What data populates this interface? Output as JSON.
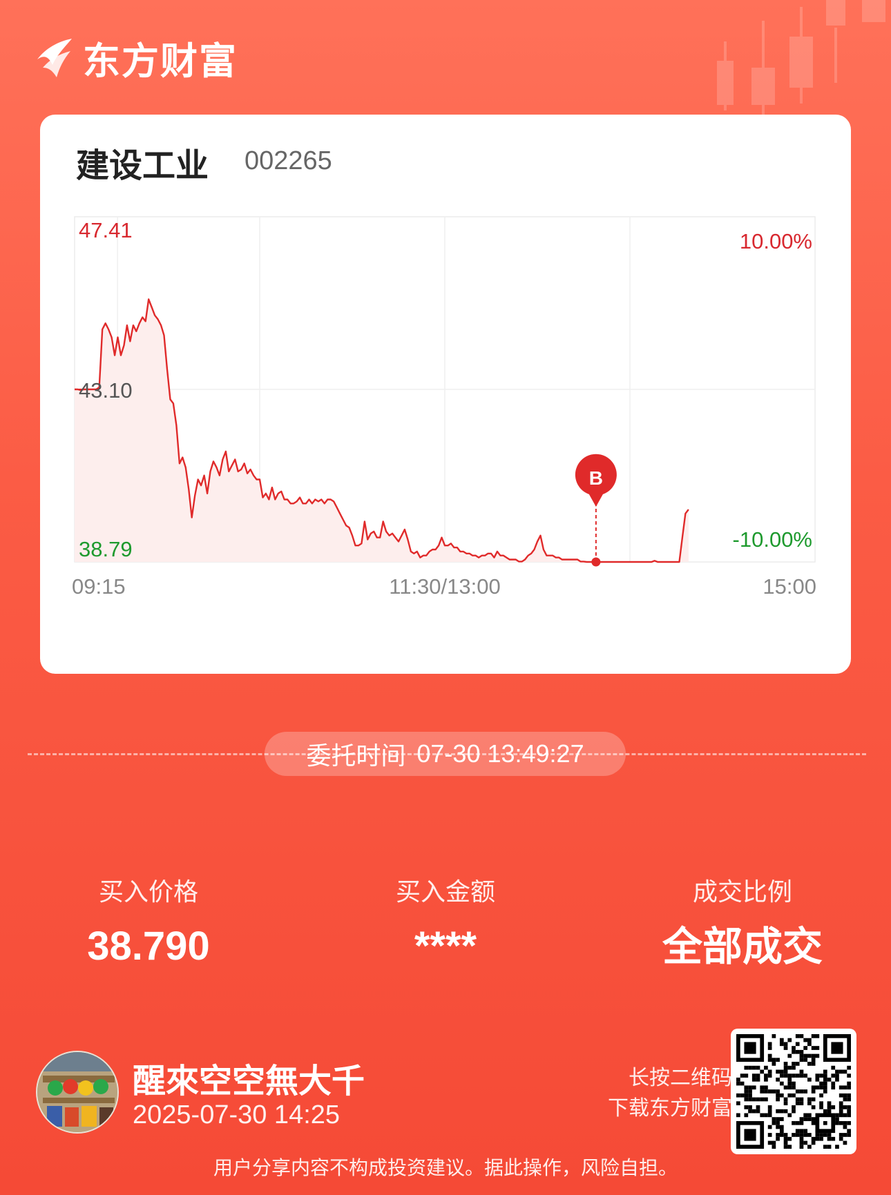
{
  "brand": {
    "name": "东方财富"
  },
  "stock": {
    "name": "建设工业",
    "code": "002265"
  },
  "chart_data": {
    "type": "line",
    "title": "",
    "xlabel": "",
    "ylabel": "",
    "x_ticks": [
      "09:15",
      "11:30/13:00",
      "15:00"
    ],
    "y_left_labels": {
      "top": "47.41",
      "mid": "43.10",
      "bottom": "38.79"
    },
    "y_right_labels": {
      "top": "10.00%",
      "bottom": "-10.00%"
    },
    "ylim": [
      38.79,
      47.41
    ],
    "reference_price": 43.1,
    "grid": true,
    "colors": {
      "line": "#e02a2a",
      "up": "#d8282f",
      "down": "#1e9a2e",
      "fill": "#fde8e6"
    },
    "series": [
      {
        "values": [
          43.1,
          43.1,
          43.08,
          43.1,
          43.1,
          43.1,
          43.1,
          43.1,
          43.15,
          44.6,
          44.75,
          44.6,
          44.4,
          43.95,
          44.4,
          43.95,
          44.2,
          44.7,
          44.3,
          44.7,
          44.55,
          44.75,
          44.9,
          44.8,
          45.35,
          45.15,
          44.95,
          44.85,
          44.7,
          44.45,
          43.6,
          42.85,
          42.75,
          42.2,
          41.25,
          41.4,
          41.15,
          40.6,
          39.9,
          40.45,
          40.85,
          40.7,
          40.95,
          40.5,
          41.05,
          41.3,
          41.15,
          40.95,
          41.35,
          41.55,
          41.05,
          41.2,
          41.35,
          41.05,
          41.1,
          41.25,
          41.0,
          41.1,
          40.95,
          40.85,
          40.85,
          40.4,
          40.5,
          40.35,
          40.65,
          40.35,
          40.5,
          40.55,
          40.35,
          40.35,
          40.25,
          40.25,
          40.3,
          40.4,
          40.25,
          40.25,
          40.35,
          40.25,
          40.35,
          40.3,
          40.35,
          40.25,
          40.35,
          40.35,
          40.3,
          40.15,
          40.0,
          39.85,
          39.7,
          39.65,
          39.45,
          39.2,
          39.2,
          39.25,
          39.8,
          39.35,
          39.5,
          39.55,
          39.4,
          39.4,
          39.8,
          39.55,
          39.45,
          39.5,
          39.4,
          39.3,
          39.45,
          39.6,
          39.35,
          39.05,
          39.0,
          39.05,
          38.9,
          38.95,
          38.95,
          39.05,
          39.1,
          39.1,
          39.2,
          39.4,
          39.2,
          39.2,
          39.25,
          39.15,
          39.15,
          39.05,
          39.05,
          39.0,
          39.0,
          38.95,
          38.95,
          38.9,
          38.95,
          38.95,
          39.0,
          39.0,
          38.9,
          39.05,
          38.95,
          38.95,
          38.9,
          38.85,
          38.85,
          38.85,
          38.8,
          38.8,
          38.85,
          38.95,
          39.0,
          39.1,
          39.3,
          39.45,
          39.1,
          38.95,
          38.95,
          38.95,
          38.9,
          38.9,
          38.85,
          38.85,
          38.85,
          38.85,
          38.85,
          38.85,
          38.8,
          38.8,
          38.79,
          38.79,
          38.79,
          38.79,
          38.79,
          38.79,
          38.79,
          38.79,
          38.79,
          38.79,
          38.79,
          38.79,
          38.79,
          38.79,
          38.79,
          38.79,
          38.79,
          38.79,
          38.79,
          38.79,
          38.79,
          38.79,
          38.82,
          38.79,
          38.79,
          38.79,
          38.79,
          38.79,
          38.79,
          38.79,
          38.79,
          39.4,
          40.0,
          40.1
        ]
      }
    ],
    "buy_marker": {
      "label": "B",
      "time": "13:49",
      "price": 38.79
    }
  },
  "entrust": {
    "label": "委托时间",
    "value": "07-30 13:49:27"
  },
  "stats": [
    {
      "label": "买入价格",
      "value": "38.790"
    },
    {
      "label": "买入金额",
      "value": "****"
    },
    {
      "label": "成交比例",
      "value": "全部成交"
    }
  ],
  "user": {
    "name": "醒來空空無大千",
    "time": "2025-07-30 14:25"
  },
  "qr_hint": {
    "line1": "长按二维码",
    "line2": "下载东方财富"
  },
  "disclaimer": "用户分享内容不构成投资建议。据此操作，风险自担。"
}
